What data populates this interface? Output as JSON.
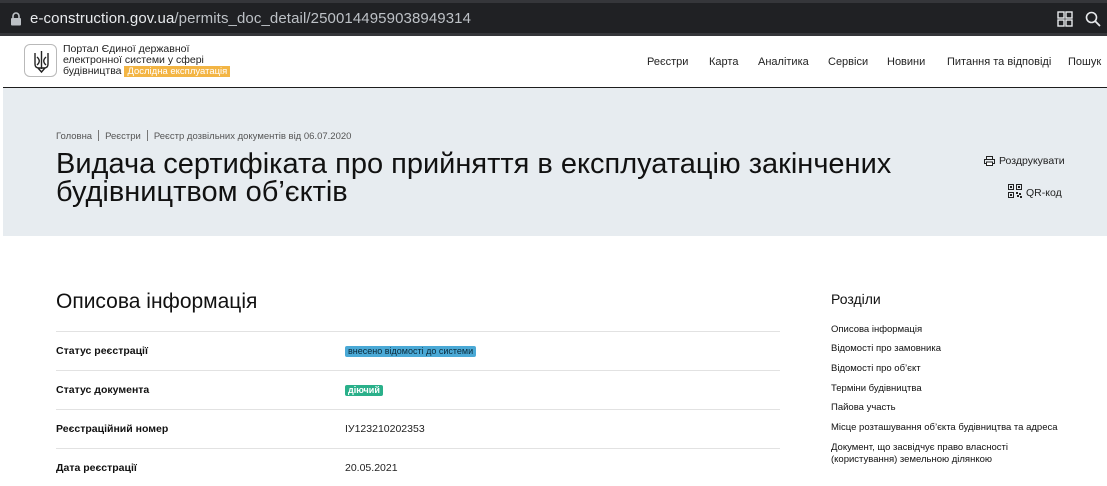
{
  "browser": {
    "url_host": "e-construction.gov.ua",
    "url_path": "/permits_doc_detail/2500144959038949314"
  },
  "header": {
    "logo_line1": "Портал Єдиної державної",
    "logo_line2": "електронної системи у сфері",
    "logo_line3": "будівництва",
    "badge": "Дослідна експлуатація",
    "nav": [
      "Реєстри",
      "Карта",
      "Аналітика",
      "Сервіси",
      "Новини",
      "Питання та відповіді",
      "Пошук"
    ]
  },
  "breadcrumb": [
    "Головна",
    "Реєстри",
    "Реєстр дозвільних документів від 06.07.2020"
  ],
  "page_title": "Видача сертифіката про прийняття в експлуатацію закінчених будівництвом об’єктів",
  "actions": {
    "print": "Роздрукувати",
    "qr": "QR-код"
  },
  "section": {
    "title": "Описова інформація",
    "rows": [
      {
        "label": "Статус реєстрації",
        "value": "внесено відомості до системи"
      },
      {
        "label": "Статус документа",
        "value": "діючий"
      },
      {
        "label": "Реєстраційний номер",
        "value": "ІУ123210202353"
      },
      {
        "label": "Дата реєстрації",
        "value": "20.05.2021"
      }
    ]
  },
  "toc": {
    "title": "Розділи",
    "items": [
      "Описова інформація",
      "Відомості про замовника",
      "Відомості про об’єкт",
      "Терміни будівництва",
      "Пайова участь",
      "Місце розташування об’єкта будівництва та адреса",
      "Документ, що засвідчує право власності (користування) земельною ділянкою"
    ]
  },
  "colors": {
    "hero_bg": "#e7ecf0",
    "badge_orange": "#f3b544",
    "chip_blue": "#4aa9d6",
    "chip_green": "#2ab08a"
  },
  "icons": {
    "lock": "lock-icon",
    "apps": "apps-icon",
    "zoom": "zoom-icon",
    "emblem": "trident-icon",
    "print": "printer-icon",
    "qr": "qr-code-icon"
  }
}
